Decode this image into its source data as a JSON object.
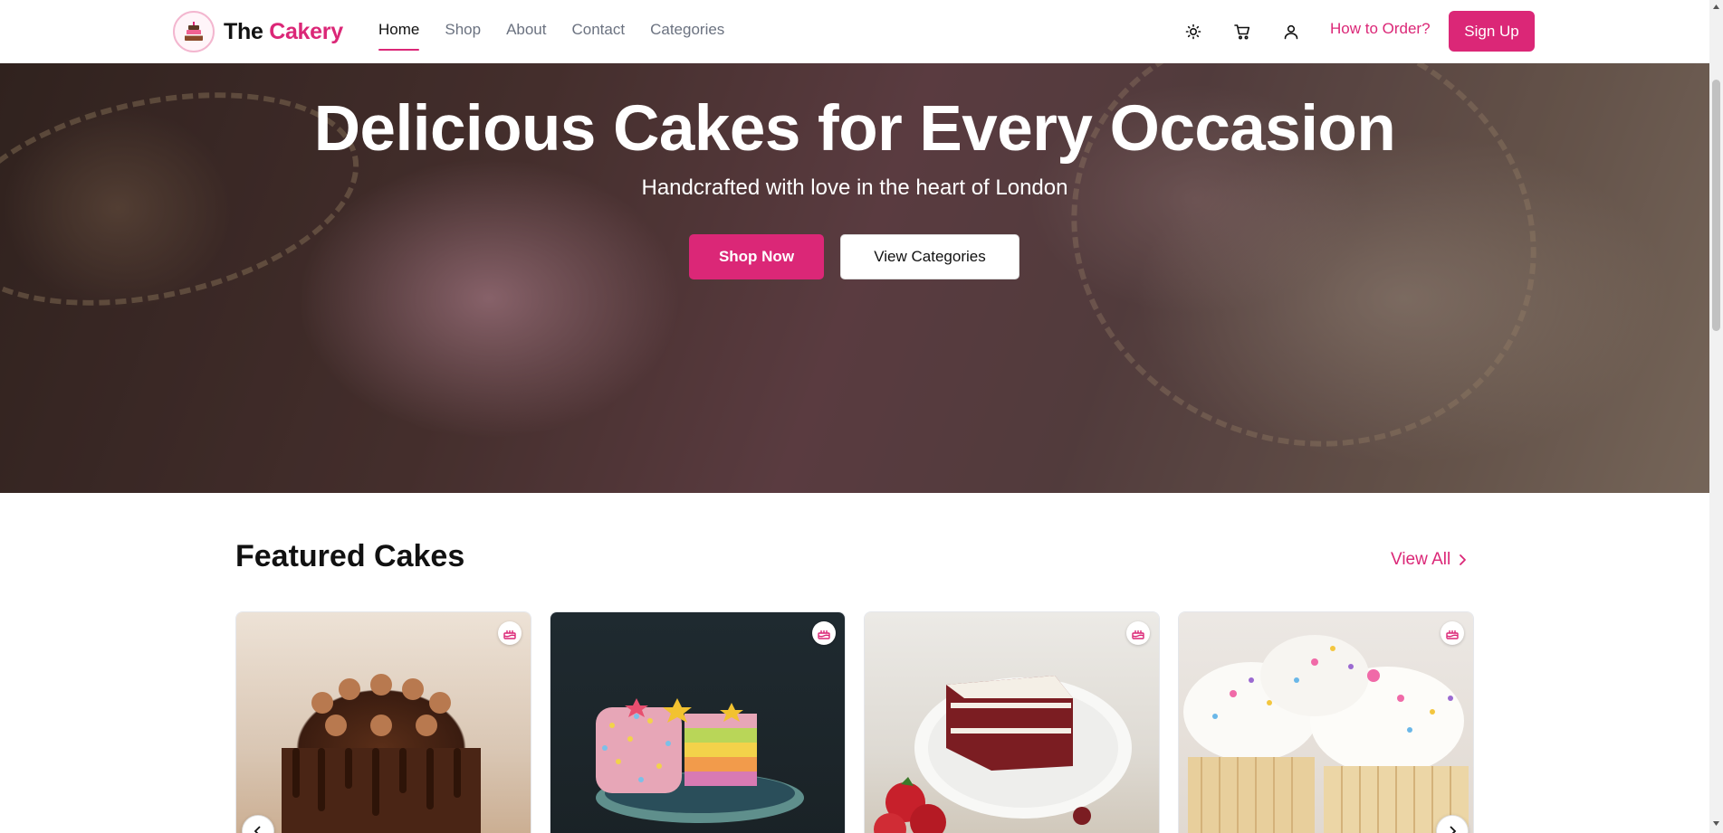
{
  "brand": {
    "prefix": "The",
    "accent": "Cakery",
    "logo_icon": "cake-icon",
    "accent_color": "#db2777"
  },
  "nav": {
    "items": [
      {
        "label": "Home",
        "active": true
      },
      {
        "label": "Shop",
        "active": false
      },
      {
        "label": "About",
        "active": false
      },
      {
        "label": "Contact",
        "active": false
      },
      {
        "label": "Categories",
        "active": false
      }
    ]
  },
  "header_actions": {
    "icons": [
      "sun-icon",
      "cart-icon",
      "user-icon"
    ],
    "how_to_order": "How to Order?",
    "sign_up": "Sign Up"
  },
  "hero": {
    "title": "Delicious Cakes for Every Occasion",
    "subtitle": "Handcrafted with love in the heart of London",
    "primary_button": "Shop Now",
    "secondary_button": "View Categories"
  },
  "featured": {
    "title": "Featured Cakes",
    "view_all": "View All",
    "cards": [
      {
        "image": "chocolate-drip-cake",
        "badge_icon": "cake-icon"
      },
      {
        "image": "rainbow-sprinkle-cake",
        "badge_icon": "cake-icon"
      },
      {
        "image": "red-velvet-slice",
        "badge_icon": "cake-icon"
      },
      {
        "image": "sprinkle-cupcakes",
        "badge_icon": "cake-icon"
      }
    ]
  }
}
